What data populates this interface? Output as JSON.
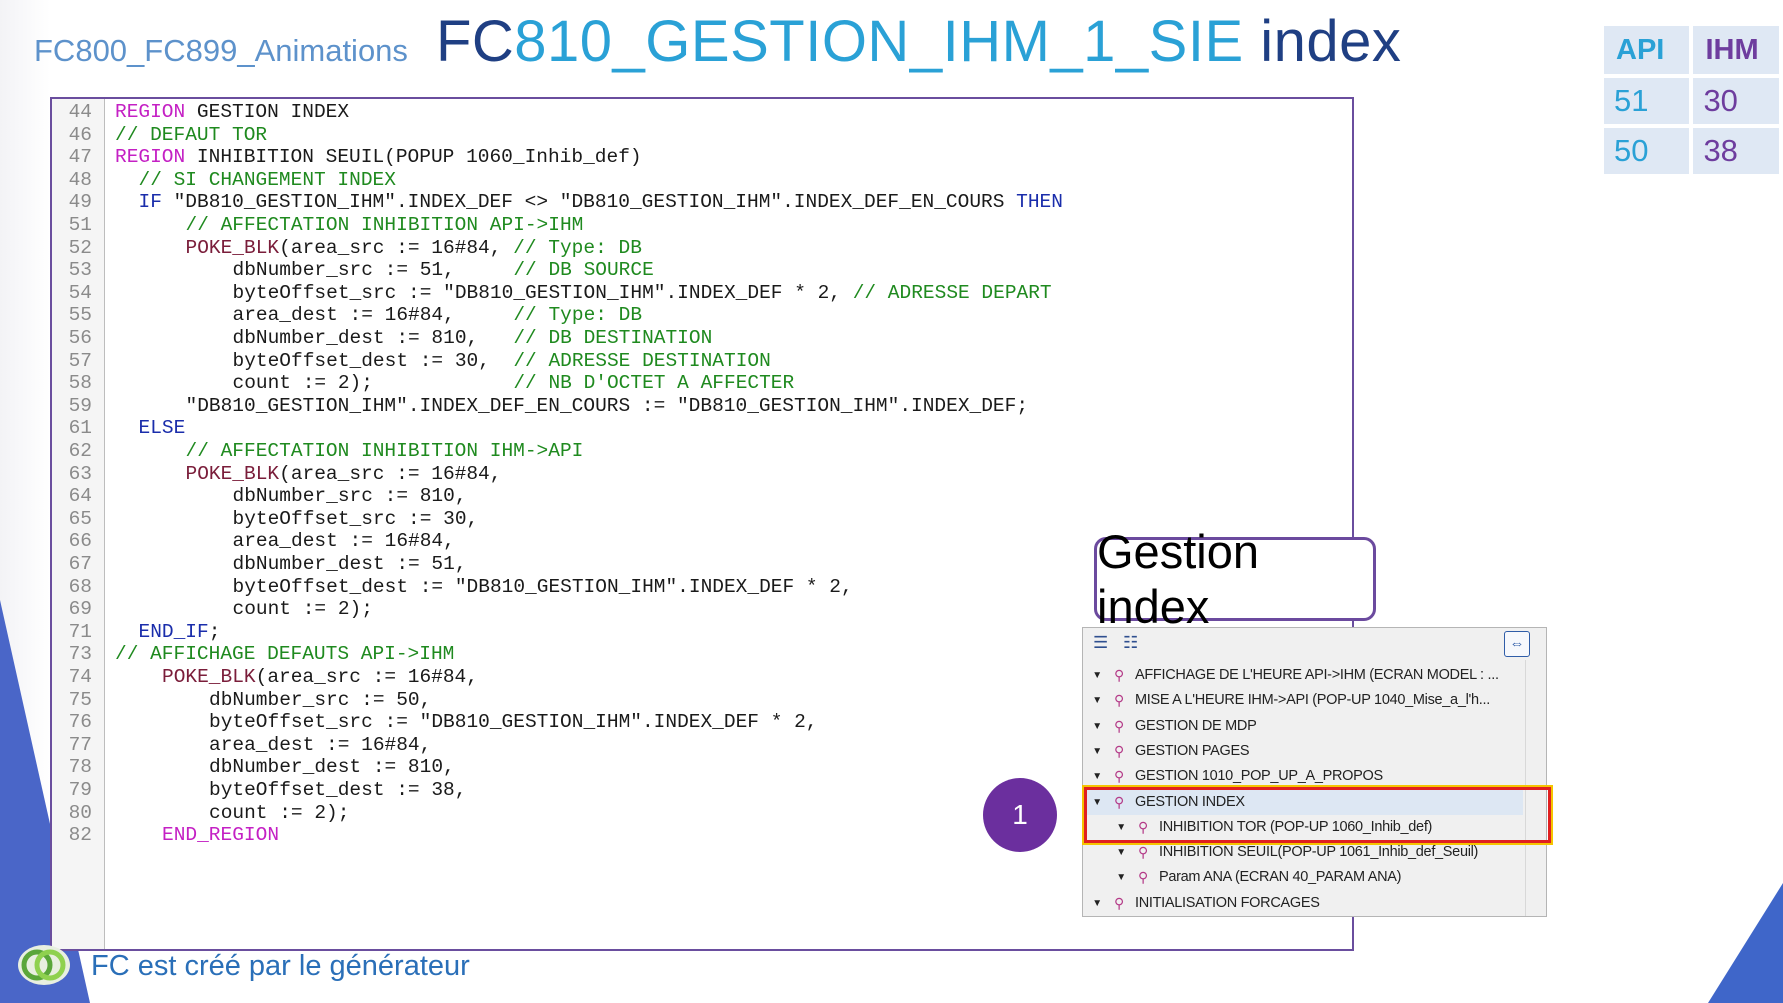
{
  "header": {
    "subtitle": "FC800_FC899_Animations",
    "title_prefix": "FC",
    "title_highlight": "810_GESTION_IHM_1_SIE",
    "title_suffix": " index"
  },
  "api_table": {
    "headers": [
      "API",
      "IHM"
    ],
    "rows": [
      [
        "51",
        "30"
      ],
      [
        "50",
        "38"
      ]
    ]
  },
  "code": {
    "lines": [
      {
        "n": "44",
        "indent": 0,
        "parts": [
          [
            "kw-region",
            "REGION"
          ],
          [
            "plain",
            " GESTION INDEX"
          ]
        ]
      },
      {
        "n": "46",
        "indent": 0,
        "parts": [
          [
            "cmt",
            "// DEFAUT TOR"
          ]
        ]
      },
      {
        "n": "47",
        "indent": 0,
        "parts": [
          [
            "kw-region",
            "REGION"
          ],
          [
            "plain",
            " INHIBITION SEUIL(POPUP 1060_Inhib_def)"
          ]
        ]
      },
      {
        "n": "48",
        "indent": 2,
        "parts": [
          [
            "cmt",
            "// SI CHANGEMENT INDEX"
          ]
        ]
      },
      {
        "n": "49",
        "indent": 2,
        "parts": [
          [
            "kw-blue",
            "IF"
          ],
          [
            "plain",
            " \"DB810_GESTION_IHM\".INDEX_DEF <> \"DB810_GESTION_IHM\".INDEX_DEF_EN_COURS "
          ],
          [
            "kw-blue",
            "THEN"
          ]
        ]
      },
      {
        "n": "51",
        "indent": 6,
        "parts": [
          [
            "cmt",
            "// AFFECTATION INHIBITION API->IHM"
          ]
        ]
      },
      {
        "n": "52",
        "indent": 6,
        "parts": [
          [
            "fn",
            "POKE_BLK"
          ],
          [
            "plain",
            "(area_src := 16#84, "
          ],
          [
            "cmt",
            "// Type: DB"
          ]
        ]
      },
      {
        "n": "53",
        "indent": 10,
        "parts": [
          [
            "plain",
            "dbNumber_src := 51,     "
          ],
          [
            "cmt",
            "// DB SOURCE"
          ]
        ]
      },
      {
        "n": "54",
        "indent": 10,
        "parts": [
          [
            "plain",
            "byteOffset_src := \"DB810_GESTION_IHM\".INDEX_DEF * 2, "
          ],
          [
            "cmt",
            "// ADRESSE DEPART"
          ]
        ]
      },
      {
        "n": "55",
        "indent": 10,
        "parts": [
          [
            "plain",
            "area_dest := 16#84,     "
          ],
          [
            "cmt",
            "// Type: DB"
          ]
        ]
      },
      {
        "n": "56",
        "indent": 10,
        "parts": [
          [
            "plain",
            "dbNumber_dest := 810,   "
          ],
          [
            "cmt",
            "// DB DESTINATION"
          ]
        ]
      },
      {
        "n": "57",
        "indent": 10,
        "parts": [
          [
            "plain",
            "byteOffset_dest := 30,  "
          ],
          [
            "cmt",
            "// ADRESSE DESTINATION"
          ]
        ]
      },
      {
        "n": "58",
        "indent": 10,
        "parts": [
          [
            "plain",
            "count := 2);            "
          ],
          [
            "cmt",
            "// NB D'OCTET A AFFECTER"
          ]
        ]
      },
      {
        "n": "59",
        "indent": 6,
        "parts": [
          [
            "plain",
            "\"DB810_GESTION_IHM\".INDEX_DEF_EN_COURS := \"DB810_GESTION_IHM\".INDEX_DEF;"
          ]
        ]
      },
      {
        "n": "61",
        "indent": 2,
        "parts": [
          [
            "kw-blue",
            "ELSE"
          ]
        ]
      },
      {
        "n": "62",
        "indent": 6,
        "parts": [
          [
            "cmt",
            "// AFFECTATION INHIBITION IHM->API"
          ]
        ]
      },
      {
        "n": "63",
        "indent": 6,
        "parts": [
          [
            "fn",
            "POKE_BLK"
          ],
          [
            "plain",
            "(area_src := 16#84,"
          ]
        ]
      },
      {
        "n": "64",
        "indent": 10,
        "parts": [
          [
            "plain",
            "dbNumber_src := 810,"
          ]
        ]
      },
      {
        "n": "65",
        "indent": 10,
        "parts": [
          [
            "plain",
            "byteOffset_src := 30,"
          ]
        ]
      },
      {
        "n": "66",
        "indent": 10,
        "parts": [
          [
            "plain",
            "area_dest := 16#84,"
          ]
        ]
      },
      {
        "n": "67",
        "indent": 10,
        "parts": [
          [
            "plain",
            "dbNumber_dest := 51,"
          ]
        ]
      },
      {
        "n": "68",
        "indent": 10,
        "parts": [
          [
            "plain",
            "byteOffset_dest := \"DB810_GESTION_IHM\".INDEX_DEF * 2,"
          ]
        ]
      },
      {
        "n": "69",
        "indent": 10,
        "parts": [
          [
            "plain",
            "count := 2);"
          ]
        ]
      },
      {
        "n": "71",
        "indent": 2,
        "parts": [
          [
            "kw-blue",
            "END_IF"
          ],
          [
            "plain",
            ";"
          ]
        ]
      },
      {
        "n": "73",
        "indent": 0,
        "parts": [
          [
            "cmt",
            "// AFFICHAGE DEFAUTS API->IHM"
          ]
        ]
      },
      {
        "n": "74",
        "indent": 4,
        "parts": [
          [
            "fn",
            "POKE_BLK"
          ],
          [
            "plain",
            "(area_src := 16#84,"
          ]
        ]
      },
      {
        "n": "75",
        "indent": 8,
        "parts": [
          [
            "plain",
            "dbNumber_src := 50,"
          ]
        ]
      },
      {
        "n": "76",
        "indent": 8,
        "parts": [
          [
            "plain",
            "byteOffset_src := \"DB810_GESTION_IHM\".INDEX_DEF * 2,"
          ]
        ]
      },
      {
        "n": "77",
        "indent": 8,
        "parts": [
          [
            "plain",
            "area_dest := 16#84,"
          ]
        ]
      },
      {
        "n": "78",
        "indent": 8,
        "parts": [
          [
            "plain",
            "dbNumber_dest := 810,"
          ]
        ]
      },
      {
        "n": "79",
        "indent": 8,
        "parts": [
          [
            "plain",
            "byteOffset_dest := 38,"
          ]
        ]
      },
      {
        "n": "80",
        "indent": 8,
        "parts": [
          [
            "plain",
            "count := 2);"
          ]
        ]
      },
      {
        "n": "82",
        "indent": 4,
        "parts": [
          [
            "kw-region",
            "END_REGION"
          ]
        ]
      }
    ]
  },
  "callout": {
    "text": "Gestion index"
  },
  "tree": {
    "items": [
      {
        "level": 0,
        "label": "AFFICHAGE DE L'HEURE API->IHM  (ECRAN MODEL : ..."
      },
      {
        "level": 0,
        "label": "MISE A L'HEURE IHM->API (POP-UP 1040_Mise_a_l'h..."
      },
      {
        "level": 0,
        "label": "GESTION DE MDP"
      },
      {
        "level": 0,
        "label": "GESTION PAGES"
      },
      {
        "level": 0,
        "label": "GESTION 1010_POP_UP_A_PROPOS"
      },
      {
        "level": 0,
        "label": "GESTION INDEX",
        "selected": true
      },
      {
        "level": 1,
        "label": "INHIBITION TOR (POP-UP 1060_Inhib_def)"
      },
      {
        "level": 1,
        "label": "INHIBITION SEUIL(POP-UP 1061_Inhib_def_Seuil)"
      },
      {
        "level": 1,
        "label": "Param ANA  (ECRAN 40_PARAM ANA)"
      },
      {
        "level": 0,
        "label": "INITIALISATION FORCAGES"
      }
    ]
  },
  "badge": {
    "text": "1"
  },
  "footer": {
    "text": "FC est créé par le générateur"
  },
  "icons": {
    "tree_arrow": "triangle-down",
    "tree_item": "region-pin",
    "toolbar": [
      "collapse-all-icon",
      "expand-all-icon",
      "fit-icon"
    ],
    "footer_logo": "green-rings-logo"
  },
  "colors": {
    "title_dark": "#1f3f83",
    "title_accent": "#2aa1d6",
    "region_keyword": "#c420c4",
    "control_keyword": "#1a2dab",
    "comment": "#1f8a1f",
    "highlight_border": "#e02020",
    "badge": "#6b2f9e"
  }
}
